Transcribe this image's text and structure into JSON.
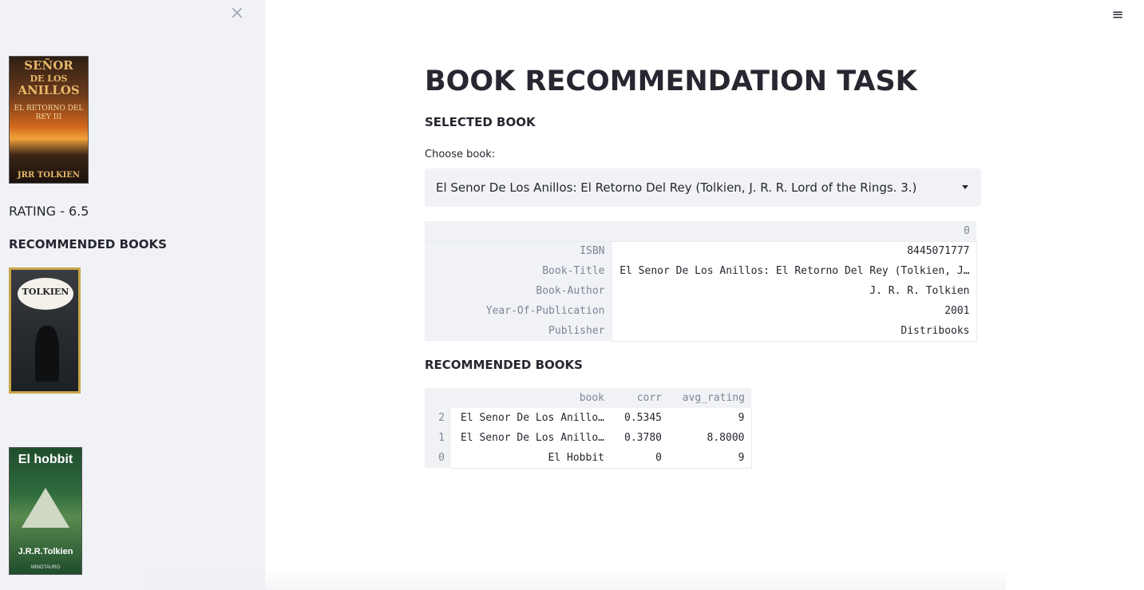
{
  "sidebar": {
    "close_icon": "×",
    "selected_cover": {
      "line1": "SEÑOR",
      "line2": "DE LOS",
      "line3": "ANILLOS",
      "subtitle": "EL RETORNO DEL REY III",
      "author": "JRR TOLKIEN"
    },
    "rating_text": "RATING - 6.5",
    "recommended_title": "RECOMMENDED BOOKS",
    "rec_cover_1": {
      "label": "TOLKIEN"
    },
    "rec_cover_2": {
      "title": "El hobbit",
      "author": "J.R.R.Tolkien",
      "publisher": "MINOTAURO"
    }
  },
  "header": {
    "menu_icon": "≡"
  },
  "main": {
    "title": "BOOK RECOMMENDATION TASK",
    "selected_heading": "SELECTED BOOK",
    "choose_label": "Choose book:",
    "selected_value": "El Senor De Los Anillos: El Retorno Del Rey (Tolkien, J. R. R. Lord of the Rings. 3.)",
    "details": {
      "column_header": "0",
      "rows": [
        {
          "key": "ISBN",
          "value": "8445071777"
        },
        {
          "key": "Book-Title",
          "value": "El Senor De Los Anillos: El Retorno Del Rey (Tolkien, J…"
        },
        {
          "key": "Book-Author",
          "value": "J. R. R. Tolkien"
        },
        {
          "key": "Year-Of-Publication",
          "value": "2001"
        },
        {
          "key": "Publisher",
          "value": "Distribooks"
        }
      ]
    },
    "recommended_heading": "RECOMMENDED BOOKS",
    "recommended_table": {
      "headers": [
        "",
        "book",
        "corr",
        "avg_rating"
      ],
      "rows": [
        {
          "idx": "2",
          "book": "El Senor De Los Anillo…",
          "corr": "0.5345",
          "avg_rating": "9"
        },
        {
          "idx": "1",
          "book": "El Senor De Los Anillo…",
          "corr": "0.3780",
          "avg_rating": "8.8000"
        },
        {
          "idx": "0",
          "book": "El Hobbit",
          "corr": "0",
          "avg_rating": "9"
        }
      ]
    }
  }
}
